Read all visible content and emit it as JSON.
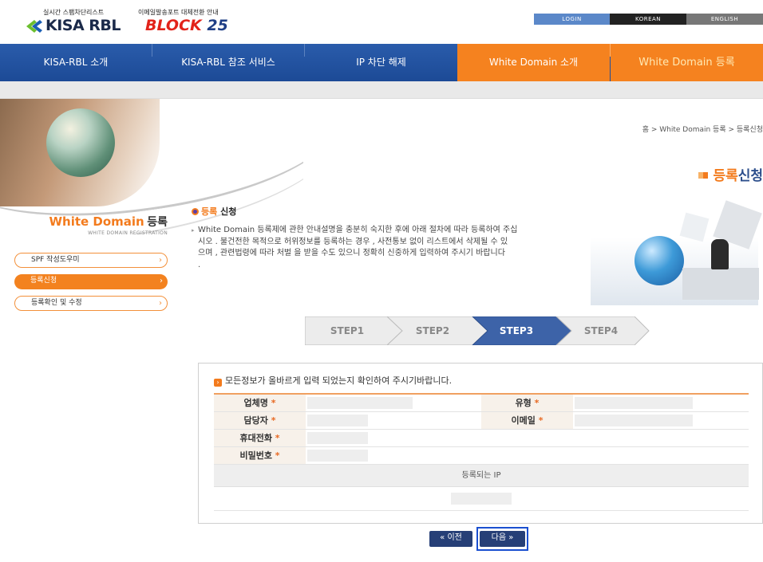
{
  "header": {
    "logo_tagline": "실시간 스팸차단리스트",
    "logo_name": "KISA RBL",
    "block_tagline": "이메일발송포트 대체전환 안내",
    "block_name": "BLOCK",
    "block_number": "25",
    "top_links": [
      "LOGIN",
      "KOREAN",
      "ENGLISH"
    ]
  },
  "nav": {
    "items": [
      "KISA-RBL 소개",
      "KISA-RBL 참조 서비스",
      "IP 차단 해제",
      "White Domain 소개",
      "White Domain 등록"
    ]
  },
  "breadcrumb": "홈 > White Domain 등록 > 등록신청",
  "page_title": {
    "accent": "등록",
    "rest": "신청"
  },
  "sidebar": {
    "title_accent": "White Domain",
    "title_rest": "등록",
    "subtitle": "WHITE DOMAIN REGISTRATION",
    "items": [
      {
        "label": "SPF 작성도우미",
        "active": false
      },
      {
        "label": "등록신청",
        "active": true
      },
      {
        "label": "등록확인 및 수정",
        "active": false
      }
    ]
  },
  "intro": {
    "title_accent": "등록",
    "title_rest": "신청",
    "line1": "White Domain 등록제에 관한 안내설명을 충분히 숙지한 후에 아래 절차에 따라 등록하여 주십",
    "line2": "시오 . 불건전한 목적으로 허위정보를 등록하는 경우 , 사전통보 없이 리스트에서 삭제될 수 있",
    "line3": "으며 , 관련법령에 따라 처벌 을 받을 수도 있으니 정확히 신중하게 입력하여 주시기 바랍니다",
    "line4": "."
  },
  "steps": [
    {
      "label": "STEP1",
      "active": false
    },
    {
      "label": "STEP2",
      "active": false
    },
    {
      "label": "STEP3",
      "active": true
    },
    {
      "label": "STEP4",
      "active": false
    }
  ],
  "form": {
    "notice": "모든정보가 올바르게 입력 되었는지 확인하여 주시기바랍니다.",
    "labels": {
      "company": "업체명",
      "type": "유형",
      "manager": "담당자",
      "email": "이메일",
      "mobile": "휴대전화",
      "password": "비밀번호"
    },
    "required_mark": "*",
    "ip_section": "등록되는 IP"
  },
  "buttons": {
    "prev": "« 이전",
    "next": "다음 »"
  },
  "colors": {
    "nav_blue": "#1f4e9c",
    "accent_orange": "#f37b1d",
    "step_active": "#3d63a8",
    "button_navy": "#263f77"
  }
}
